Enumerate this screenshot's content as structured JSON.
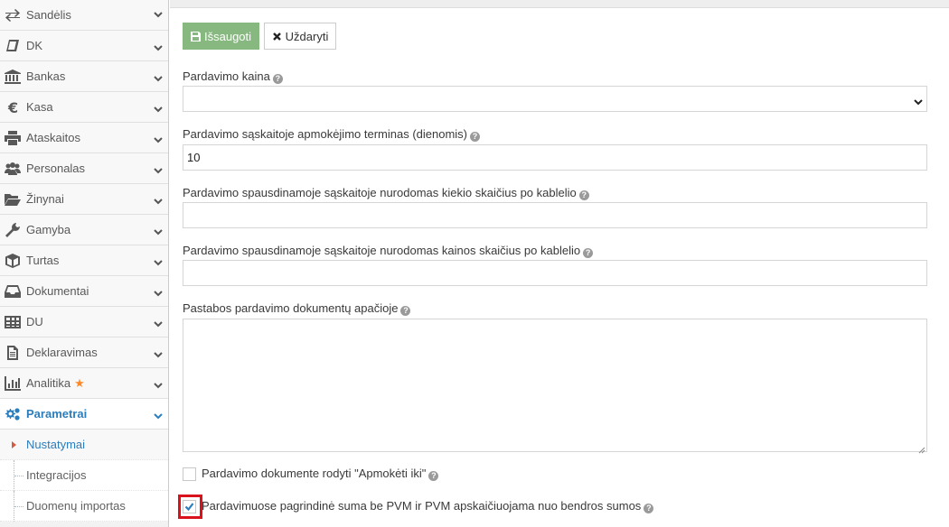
{
  "sidebar": {
    "items": [
      {
        "label": "Sandėlis",
        "icon": "exchange-icon"
      },
      {
        "label": "DK",
        "icon": "book-icon"
      },
      {
        "label": "Bankas",
        "icon": "bank-icon"
      },
      {
        "label": "Kasa",
        "icon": "euro-icon"
      },
      {
        "label": "Ataskaitos",
        "icon": "print-icon"
      },
      {
        "label": "Personalas",
        "icon": "users-icon"
      },
      {
        "label": "Žinynai",
        "icon": "folder-open-icon"
      },
      {
        "label": "Gamyba",
        "icon": "wrench-icon"
      },
      {
        "label": "Turtas",
        "icon": "cube-icon"
      },
      {
        "label": "Dokumentai",
        "icon": "inbox-icon"
      },
      {
        "label": "DU",
        "icon": "table-icon"
      },
      {
        "label": "Deklaravimas",
        "icon": "file-text-icon"
      },
      {
        "label": "Analitika",
        "icon": "bar-chart-icon"
      },
      {
        "label": "Parametrai",
        "icon": "cogs-icon"
      }
    ],
    "subitems": [
      {
        "label": "Nustatymai"
      },
      {
        "label": "Integracijos"
      },
      {
        "label": "Duomenų importas"
      }
    ]
  },
  "toolbar": {
    "save_label": "Išsaugoti",
    "close_label": "Uždaryti"
  },
  "form": {
    "price_label": "Pardavimo kaina",
    "price_value": "",
    "term_label": "Pardavimo sąskaitoje apmokėjimo terminas (dienomis)",
    "term_value": "10",
    "qty_decimals_label": "Pardavimo spausdinamoje sąskaitoje nurodomas kiekio skaičius po kablelio",
    "qty_decimals_value": "",
    "price_decimals_label": "Pardavimo spausdinamoje sąskaitoje nurodomas kainos skaičius po kablelio",
    "price_decimals_value": "",
    "notes_label": "Pastabos pardavimo dokumentų apačioje",
    "notes_value": "",
    "show_paid_until_label": "Pardavimo dokumente rodyti \"Apmokėti iki\"",
    "show_paid_until_checked": false,
    "vat_calc_label": "Pardavimuose pagrindinė suma be PVM ir PVM apskaičiuojama nuo bendros sumos",
    "vat_calc_checked": true
  },
  "colors": {
    "accent": "#2b7dbc",
    "save_button": "#87b87f",
    "highlight": "#d9121b",
    "star": "#ff892a"
  }
}
